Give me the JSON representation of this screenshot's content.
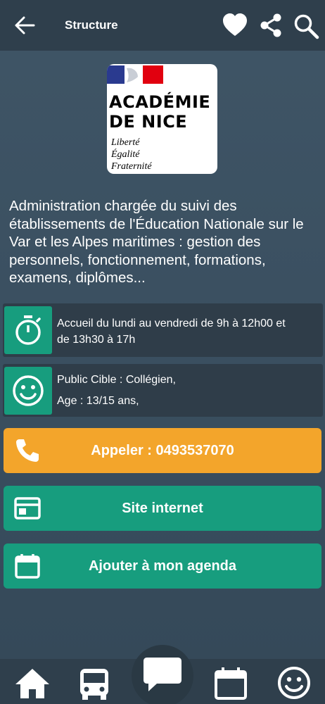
{
  "header": {
    "title": "Structure"
  },
  "logo": {
    "line1": "ACADÉMIE",
    "line2": "DE NICE",
    "motto1": "Liberté",
    "motto2": "Égalité",
    "motto3": "Fraternité"
  },
  "description": "Administration chargée du suivi des établissements de l'Éducation Nationale sur le Var et les Alpes maritimes : gestion des personnels, fonctionnement, formations, examens, diplômes...",
  "hours": {
    "line1": "Accueil du lundi au vendredi de 9h à 12h00 et",
    "line2": "de 13h30 à 17h"
  },
  "audience": {
    "line1": "Public Cible : Collégien,",
    "line2": "Age : 13/15 ans,"
  },
  "buttons": {
    "call": "Appeler : 0493537070",
    "website": "Site internet",
    "agenda": "Ajouter à mon agenda"
  },
  "colors": {
    "accent_green": "#179d7e",
    "accent_orange": "#f3a52b",
    "bar": "#2f3f4c"
  },
  "icons": {
    "back": "arrow-left-icon",
    "favorite": "heart-icon",
    "share": "share-icon",
    "search": "search-icon",
    "hours": "stopwatch-icon",
    "audience": "smiley-icon",
    "call": "phone-icon",
    "website": "browser-window-icon",
    "agenda": "calendar-icon",
    "nav": [
      "home-icon",
      "bus-icon",
      "chat-icon",
      "calendar-icon",
      "smiley-icon"
    ]
  }
}
